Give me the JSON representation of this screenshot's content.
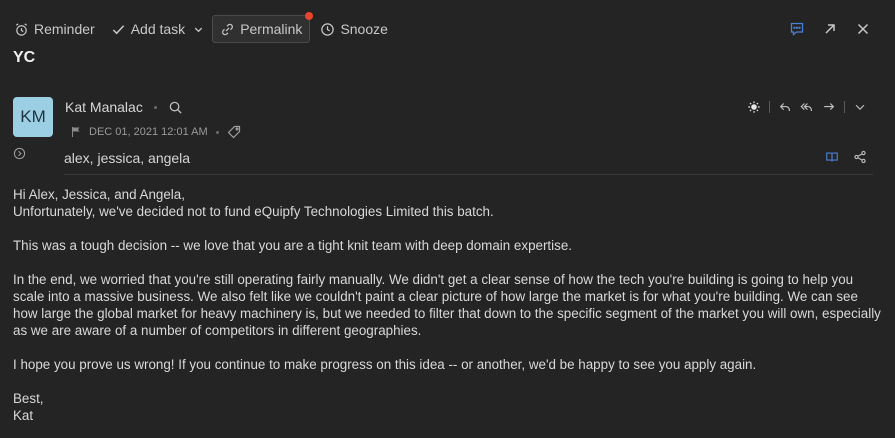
{
  "toolbar": {
    "reminder_label": "Reminder",
    "add_task_label": "Add task",
    "permalink_label": "Permalink",
    "snooze_label": "Snooze"
  },
  "email": {
    "subject": "YC",
    "avatar_initials": "KM",
    "sender_name": "Kat Manalac",
    "date": "DEC 01, 2021 12:01 AM",
    "recipients": "alex, jessica, angela",
    "body": {
      "greeting": "Hi Alex, Jessica, and Angela,",
      "line1": "Unfortunately, we've decided not to fund eQuipfy Technologies Limited this batch.",
      "para2": "This was a tough decision -- we love that you are a tight knit team with deep domain expertise.",
      "para3": "In the end, we worried that you're still operating fairly manually. We didn't get a clear sense of how the tech you're building is going to help you scale into a massive business. We also felt like we couldn't paint a clear picture of how large the market is for what you're building. We can see how large the global market for heavy machinery is, but we needed to filter that down to the specific segment of the market you will own, especially as we are aware of a number of competitors in different geographies.",
      "para4": "I hope you prove us wrong! If you continue to make progress on this idea -- or another,  we'd be happy to see you apply again.",
      "signoff": "Best,",
      "signature": "Kat"
    }
  },
  "colors": {
    "background": "#242424",
    "avatar": "#9ccfe3",
    "notification_dot": "#e8452f",
    "accent_icon": "#4a7fd4"
  }
}
